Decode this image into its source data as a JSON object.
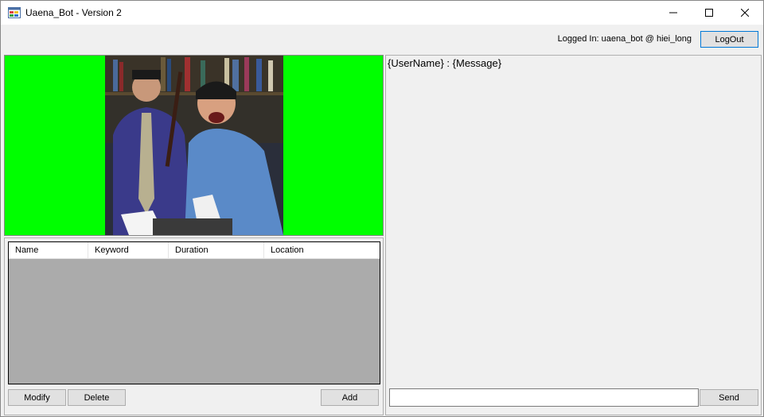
{
  "window": {
    "title": "Uaena_Bot - Version 2"
  },
  "header": {
    "login_status": "Logged In: uaena_bot @ hiei_long",
    "logout_label": "LogOut"
  },
  "table": {
    "columns": [
      "Name",
      "Keyword",
      "Duration",
      "Location"
    ]
  },
  "actions": {
    "modify_label": "Modify",
    "delete_label": "Delete",
    "add_label": "Add"
  },
  "chat": {
    "log_text": "{UserName} : {Message}",
    "input_value": "",
    "send_label": "Send"
  },
  "colors": {
    "chroma_green": "#00ff00",
    "accent": "#0078d7",
    "table_bg": "#ababab"
  }
}
